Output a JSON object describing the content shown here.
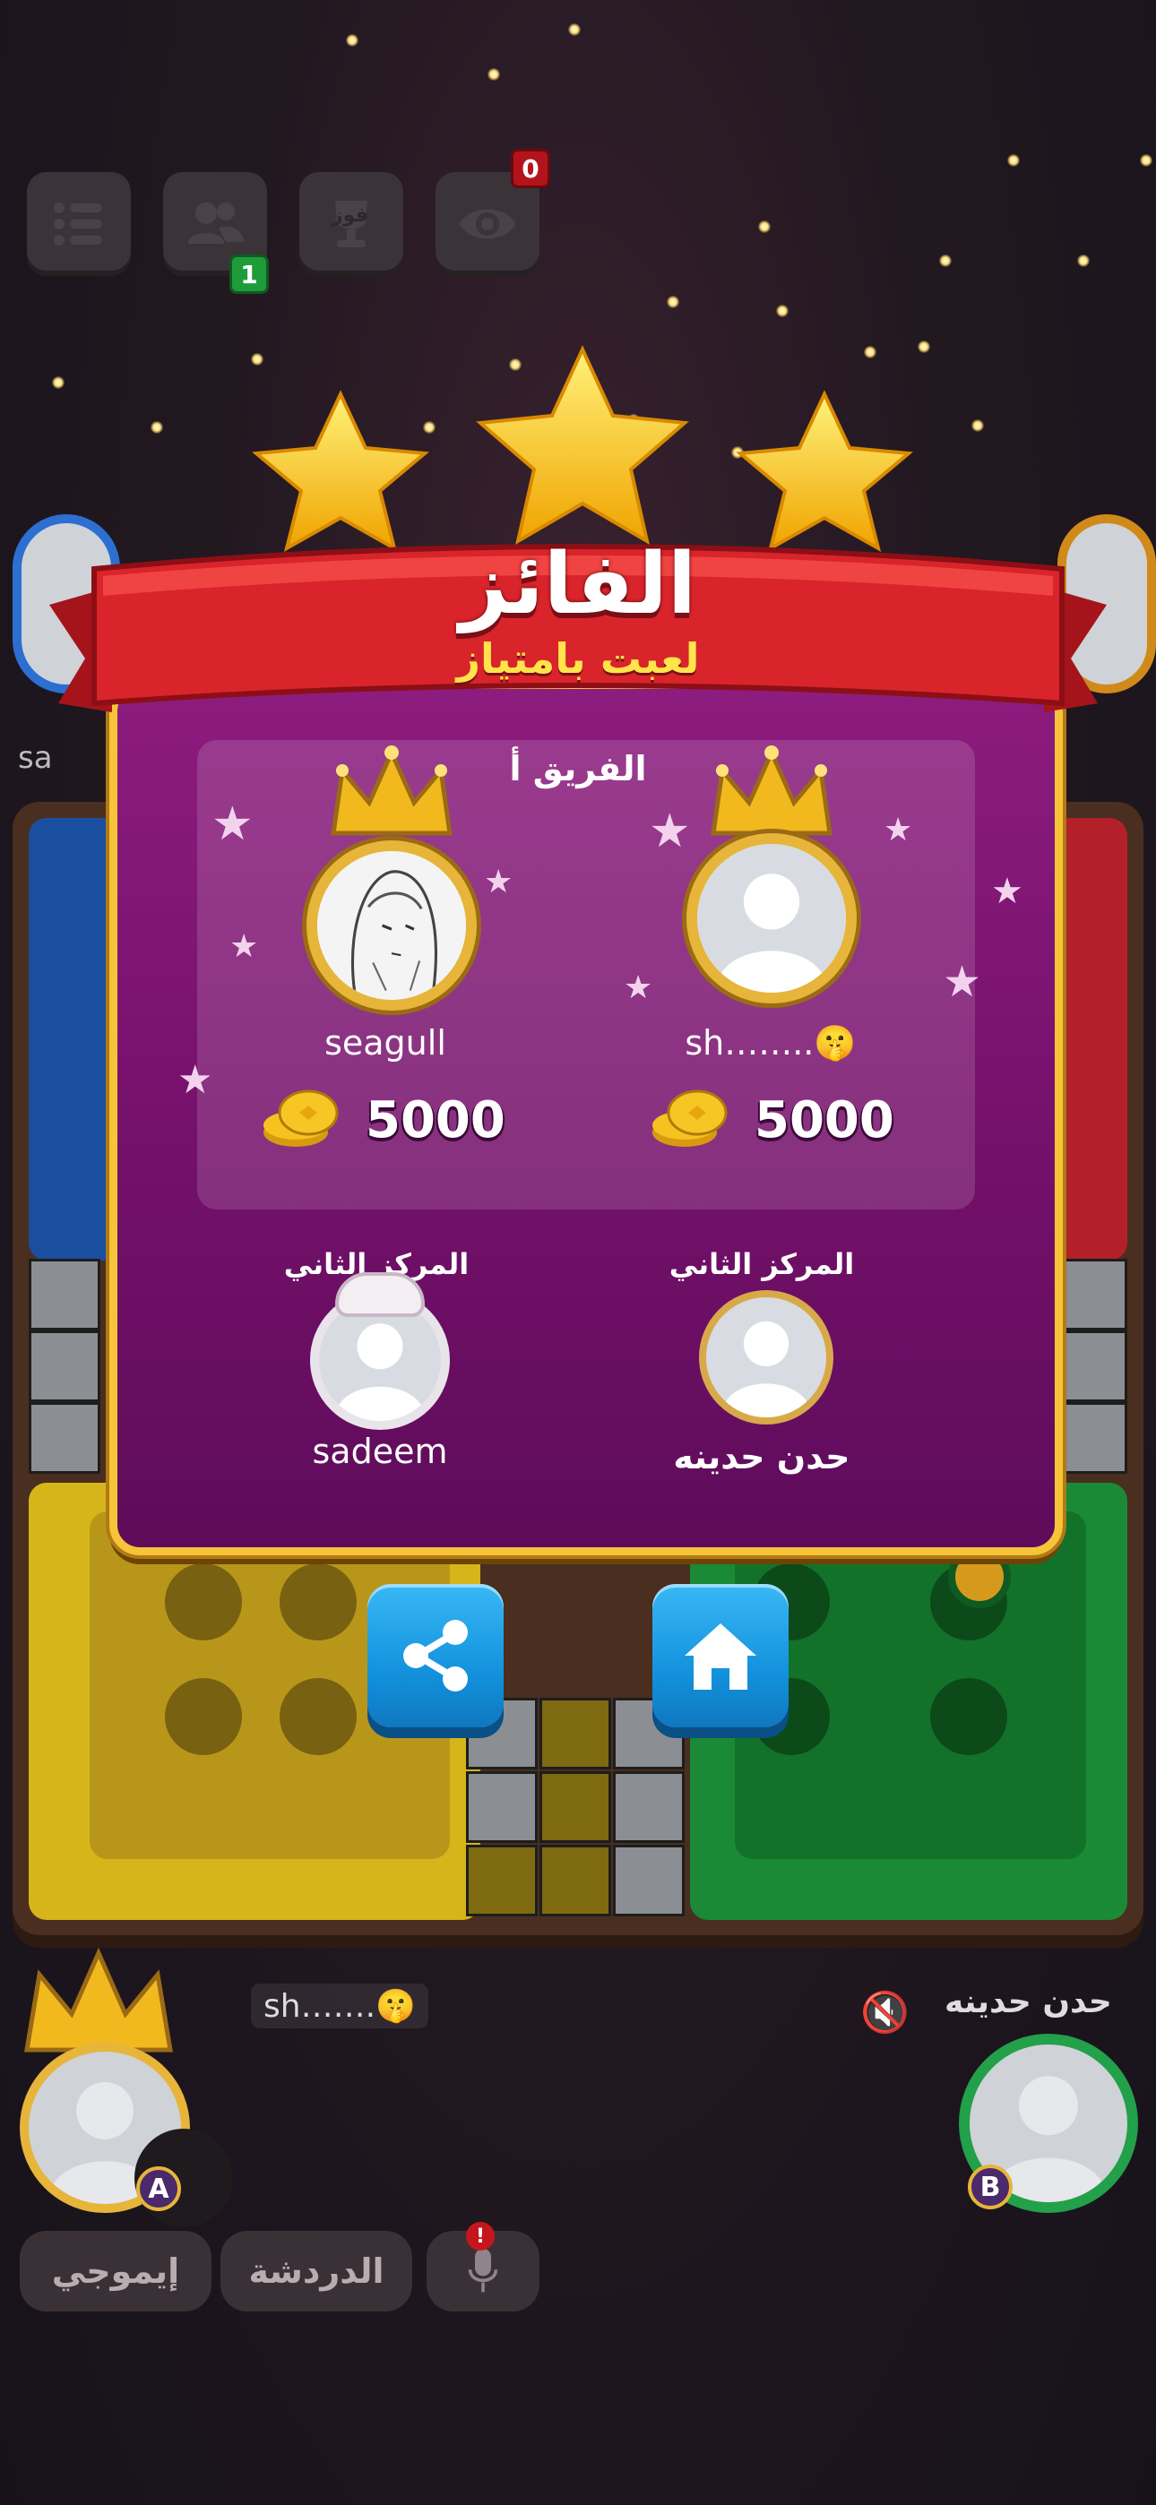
{
  "top_bar": {
    "menu_icon": "list-icon",
    "friends_icon": "people-icon",
    "friends_badge": "1",
    "trophy_icon": "trophy-icon",
    "trophy_label": "فوز",
    "spectators_icon": "eye-icon",
    "spectators_badge": "0"
  },
  "winner_modal": {
    "title": "الفائز",
    "subtitle": "لعبت بامتياز",
    "stars": 3,
    "team_label": "الفريق أ",
    "winners": [
      {
        "name": "seagull",
        "coins": "5000",
        "coin_icon": "coin-stack-icon"
      },
      {
        "name": "sh……..🤫",
        "coins": "5000",
        "coin_icon": "coin-stack-icon"
      }
    ],
    "runners_up": [
      {
        "place": "المركز الثاني",
        "name": "sadeem"
      },
      {
        "place": "المركز الثاني",
        "name": "حدن حدينه"
      }
    ],
    "share_icon": "share-icon",
    "home_icon": "home-icon"
  },
  "players": {
    "left_name": "sh…….🤫",
    "left_badge": "A",
    "left_side_name": "sa",
    "right_name": "حدن حدينه",
    "right_badge": "B",
    "right_mute_icon": "speaker-muted-icon"
  },
  "bottom_bar": {
    "emoji_label": "إيموجي",
    "chat_label": "الدردشة",
    "mic_icon": "microphone-icon",
    "mic_badge": "!"
  },
  "colors": {
    "gold": "#f7c338",
    "panel_purple": "#7c1474",
    "banner_red": "#d9242b",
    "subtitle_yellow": "#ffe44a",
    "button_blue": "#1b9fe6",
    "blue_quadrant": "#1a4fa0",
    "red_quadrant": "#b3202a",
    "yellow_quadrant": "#d6b51a",
    "green_quadrant": "#1a8a36"
  }
}
